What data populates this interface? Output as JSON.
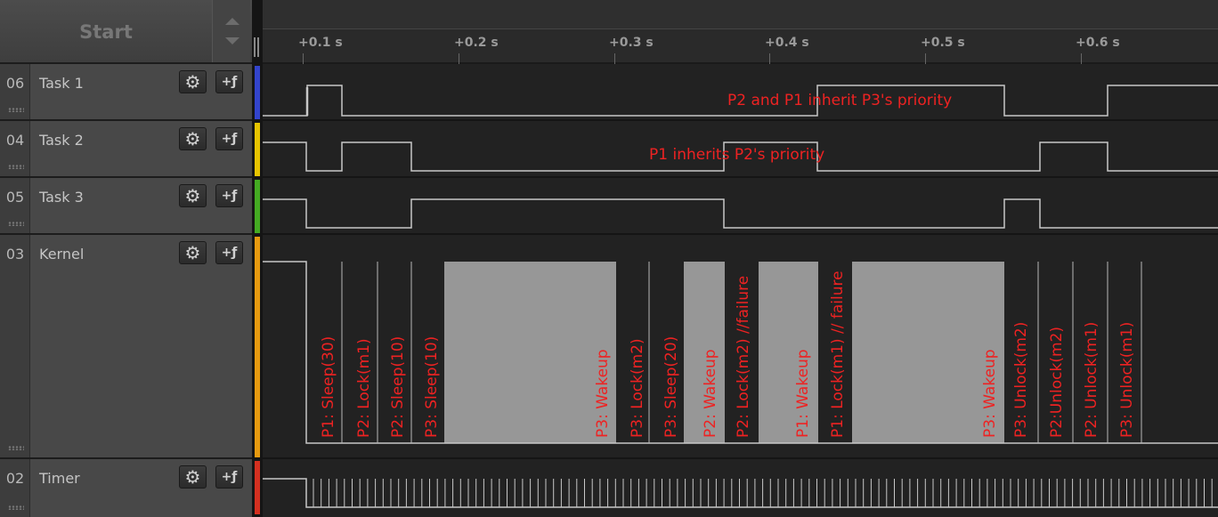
{
  "header": {
    "start_label": "Start"
  },
  "ruler": {
    "ticks": [
      "+0.1 s",
      "+0.2 s",
      "+0.3 s",
      "+0.4 s",
      "+0.5 s",
      "+0.6 s"
    ]
  },
  "channels": [
    {
      "id": "06",
      "name": "Task 1",
      "color": "#3344cc",
      "gear": "⚙",
      "trigger": "+ƒ"
    },
    {
      "id": "04",
      "name": "Task 2",
      "color": "#e6c400",
      "gear": "⚙",
      "trigger": "+ƒ"
    },
    {
      "id": "05",
      "name": "Task 3",
      "color": "#44aa22",
      "gear": "⚙",
      "trigger": "+ƒ"
    },
    {
      "id": "03",
      "name": "Kernel",
      "color": "#e69a10",
      "gear": "⚙",
      "trigger": "+ƒ"
    },
    {
      "id": "02",
      "name": "Timer",
      "color": "#d43020",
      "gear": "⚙",
      "trigger": "+ƒ"
    }
  ],
  "annotations": {
    "task1": "P2 and P1 inherit P3's priority",
    "task2": "P1 inherits P2's priority"
  },
  "kernel_labels": [
    "P1: Sleep(30)",
    "P2: Lock(m1)",
    "P2: Sleep(10)",
    "P3: Sleep(10)",
    "P3: Wakeup",
    "P3: Lock(m2)",
    "P3: Sleep(20)",
    "P2: Wakeup",
    "P2: Lock(m2) //failure",
    "P1: Wakeup",
    "P1: Lock(m1) // failure",
    "P3: Wakeup",
    "P3: Unlock(m2)",
    "P2:Unlock(m2)",
    "P2: Unlock(m1)",
    "P3: Unlock(m1)"
  ],
  "colors": {
    "annotation": "#ee2222",
    "trace": "#c8c8c8",
    "busy_fill": "#979797"
  }
}
